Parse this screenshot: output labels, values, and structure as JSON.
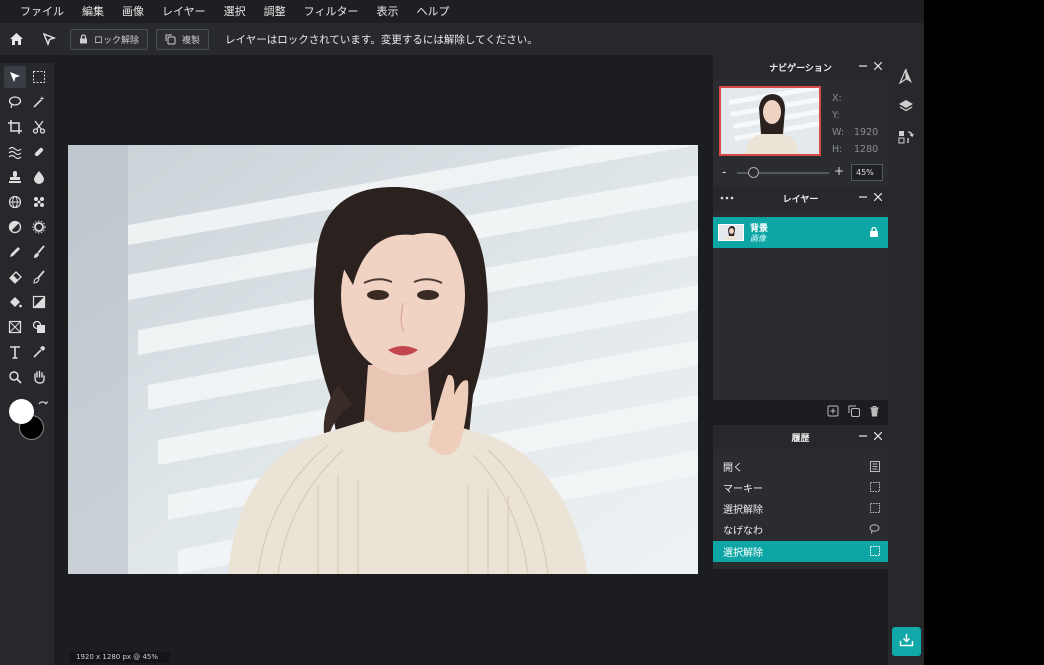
{
  "menu": [
    "ファイル",
    "編集",
    "画像",
    "レイヤー",
    "選択",
    "調整",
    "フィルター",
    "表示",
    "ヘルプ"
  ],
  "options": {
    "unlock_label": "ロック解除",
    "duplicate_label": "複製",
    "message": "レイヤーはロックされています。変更するには解除してください。"
  },
  "navigator": {
    "title": "ナビゲーション",
    "x_label": "X:",
    "x_value": "",
    "y_label": "Y:",
    "y_value": "",
    "w_label": "W:",
    "w_value": "1920",
    "h_label": "H:",
    "h_value": "1280",
    "zoom_value": "45%",
    "zoom_fraction": 0.45
  },
  "layers": {
    "title": "レイヤー",
    "items": [
      {
        "name": "背景",
        "type": "画像",
        "locked": true
      }
    ]
  },
  "history": {
    "title": "履歴",
    "items": [
      {
        "label": "開く",
        "icon": "document-icon",
        "selected": false
      },
      {
        "label": "マーキー",
        "icon": "marquee-icon",
        "selected": false
      },
      {
        "label": "選択解除",
        "icon": "marquee-icon",
        "selected": false
      },
      {
        "label": "なげなわ",
        "icon": "lasso-icon",
        "selected": false
      },
      {
        "label": "選択解除",
        "icon": "marquee-icon",
        "selected": true
      }
    ]
  },
  "status": {
    "text": "1920 x 1280 px @ 45%"
  },
  "colors": {
    "accent": "#0ea5a5",
    "foreground_color": "#ffffff",
    "background_color": "#000000"
  }
}
